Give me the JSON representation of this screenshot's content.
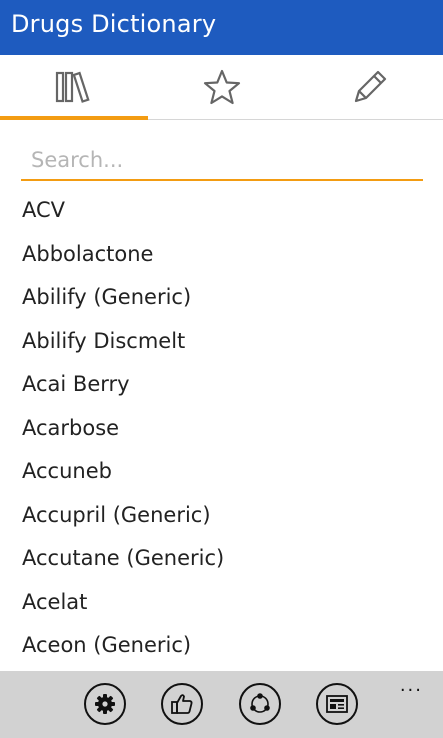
{
  "app": {
    "title": "Drugs Dictionary"
  },
  "tabs": [
    {
      "name": "library",
      "icon": "library-icon",
      "active": true
    },
    {
      "name": "favorites",
      "icon": "star-icon",
      "active": false
    },
    {
      "name": "notes",
      "icon": "pencil-icon",
      "active": false
    }
  ],
  "search": {
    "placeholder": "Search...",
    "value": ""
  },
  "drugs": [
    "ACV",
    "Abbolactone",
    "Abilify (Generic)",
    "Abilify Discmelt",
    "Acai Berry",
    "Acarbose",
    "Accuneb",
    "Accupril (Generic)",
    "Accutane (Generic)",
    "Acelat",
    "Aceon (Generic)"
  ],
  "appbar": {
    "buttons": [
      "settings-icon",
      "thumbs-up-icon",
      "share-icon",
      "news-icon"
    ],
    "more": "..."
  },
  "colors": {
    "accent": "#1e5bbf",
    "highlight": "#f39c12",
    "appbar": "#d2d2d2"
  }
}
